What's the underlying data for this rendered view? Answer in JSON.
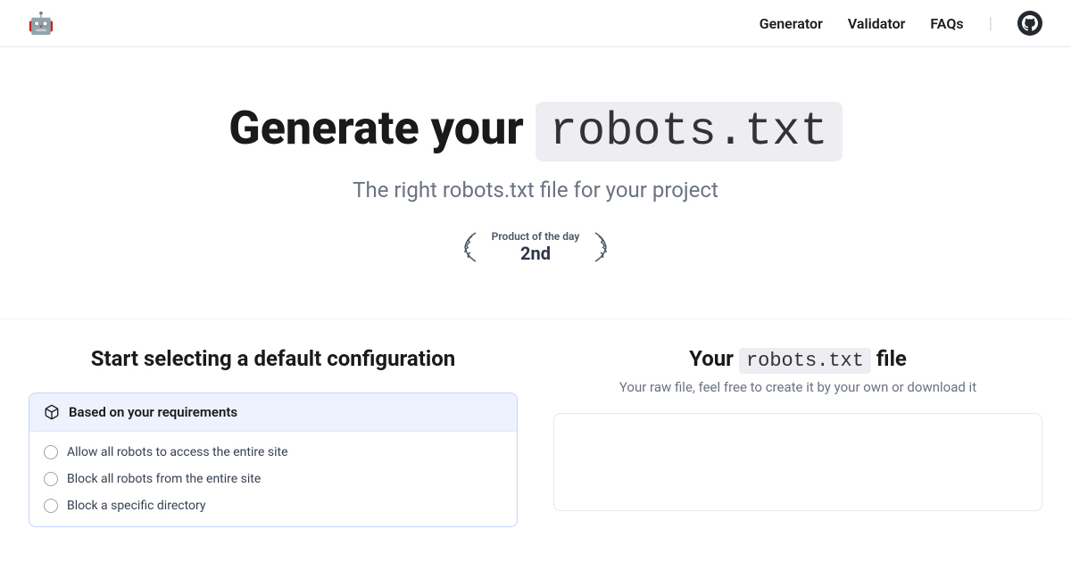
{
  "nav": {
    "links": [
      "Generator",
      "Validator",
      "FAQs"
    ]
  },
  "hero": {
    "title_prefix": "Generate your ",
    "title_code": "robots.txt",
    "subtitle": "The right robots.txt file for your project"
  },
  "badge": {
    "label": "Product of the day",
    "rank": "2nd"
  },
  "left": {
    "title": "Start selecting a default configuration",
    "config_header": "Based on your requirements",
    "options": [
      "Allow all robots to access the entire site",
      "Block all robots from the entire site",
      "Block a specific directory"
    ]
  },
  "right": {
    "title_prefix": "Your ",
    "title_code": "robots.txt",
    "title_suffix": " file",
    "subtitle": "Your raw file, feel free to create it by your own or download it"
  }
}
